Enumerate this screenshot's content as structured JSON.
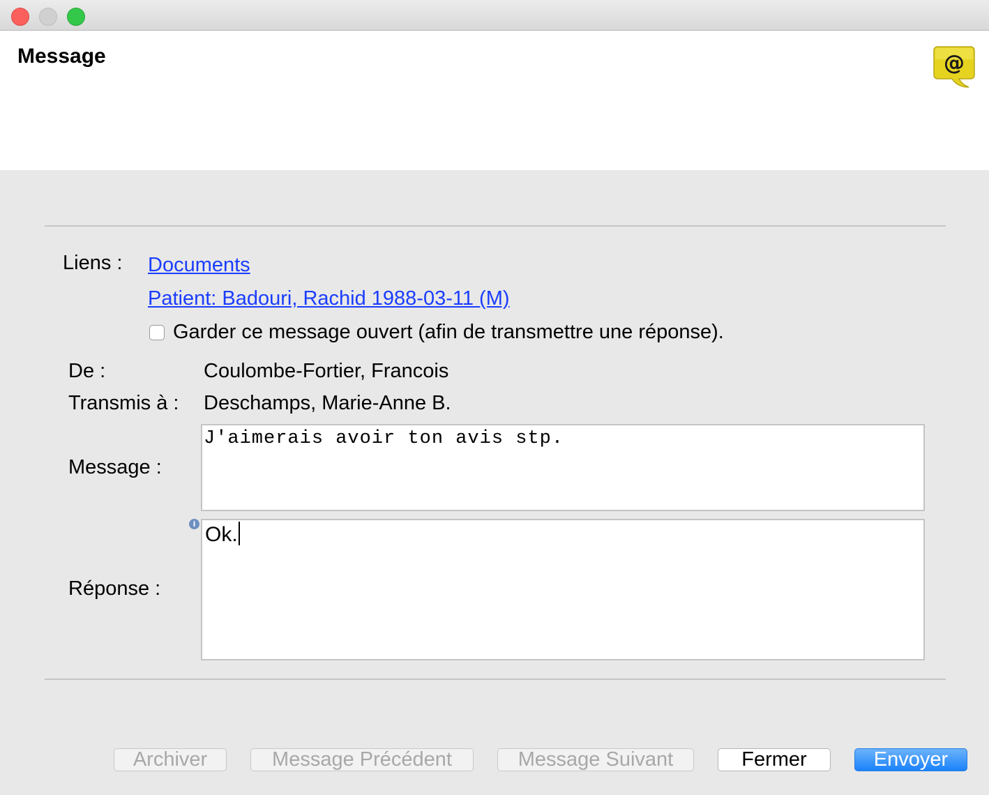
{
  "window": {
    "title": "Message"
  },
  "links": {
    "label": "Liens :",
    "documents": "Documents",
    "patient": "Patient: Badouri, Rachid 1988-03-11 (M)"
  },
  "keep_open": {
    "label": "Garder ce message ouvert (afin de transmettre une réponse).",
    "checked": false
  },
  "from": {
    "label": "De :",
    "value": "Coulombe-Fortier, Francois"
  },
  "to": {
    "label": "Transmis à :",
    "value": "Deschamps, Marie-Anne B."
  },
  "message": {
    "label": "Message :",
    "text": "J'aimerais avoir ton avis stp."
  },
  "reply": {
    "label": "Réponse :",
    "text": "Ok."
  },
  "buttons": {
    "archive": "Archiver",
    "previous": "Message Précédent",
    "next": "Message Suivant",
    "close": "Fermer",
    "send": "Envoyer"
  },
  "icons": {
    "header": "email-at-speech-bubble-icon",
    "info": "info-icon"
  },
  "colors": {
    "link": "#1a3dff",
    "primary_button": "#1a82fb",
    "icon_yellow": "#e6d320"
  }
}
